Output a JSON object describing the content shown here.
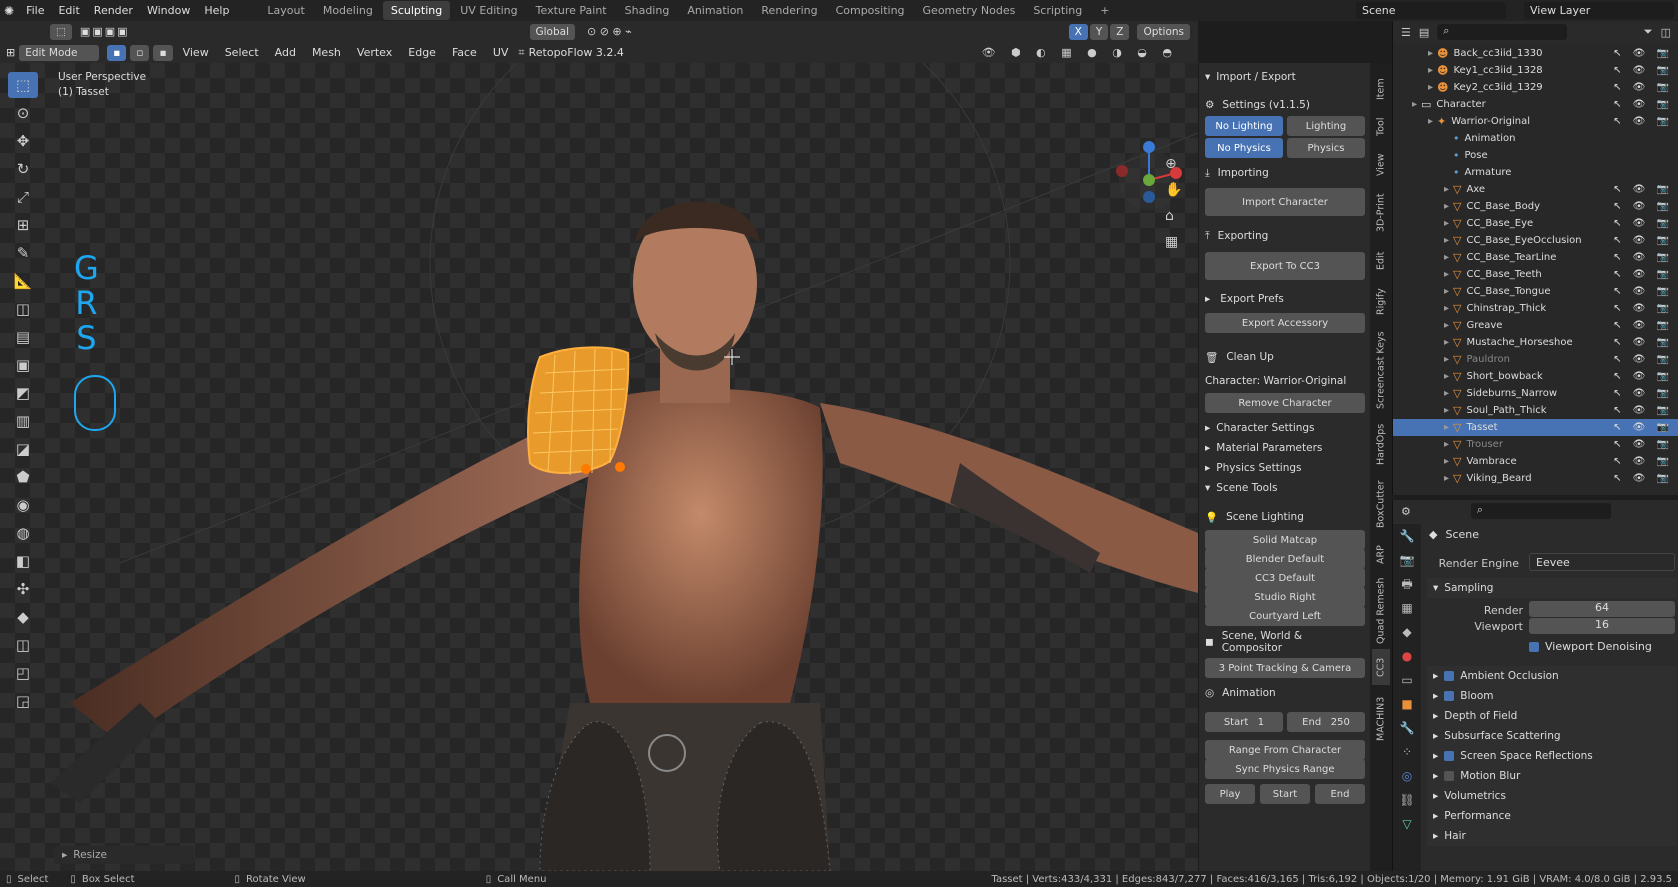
{
  "topbar": {
    "menus": [
      "File",
      "Edit",
      "Render",
      "Window",
      "Help"
    ],
    "workspaces": [
      "Layout",
      "Modeling",
      "Sculpting",
      "UV Editing",
      "Texture Paint",
      "Shading",
      "Animation",
      "Rendering",
      "Compositing",
      "Geometry Nodes",
      "Scripting"
    ],
    "active_workspace": "Sculpting",
    "scene": "Scene",
    "view_layer": "View Layer"
  },
  "header": {
    "mode": "Edit Mode",
    "menus": [
      "View",
      "Select",
      "Add",
      "Mesh",
      "Vertex",
      "Edge",
      "Face",
      "UV"
    ],
    "addon": "RetopoFlow 3.2.4",
    "orientation": "Global",
    "options": "Options"
  },
  "viewport": {
    "perspective": "User Perspective",
    "object": "(1) Tasset",
    "overlay_keys": [
      "G",
      "R",
      "S"
    ],
    "resize_panel": "Resize"
  },
  "npanel": {
    "section_title": "Import / Export",
    "settings_label": "Settings  (v1.1.5)",
    "no_lighting": "No Lighting",
    "lighting": "Lighting",
    "no_physics": "No Physics",
    "physics": "Physics",
    "importing": "Importing",
    "import_character": "Import Character",
    "exporting": "Exporting",
    "export_cc3": "Export To CC3",
    "export_prefs": "Export Prefs",
    "export_accessory": "Export Accessory",
    "clean_up": "Clean Up",
    "character": "Character: Warrior-Original",
    "remove_character": "Remove Character",
    "collapsed": [
      "Character Settings",
      "Material Parameters",
      "Physics Settings"
    ],
    "scene_tools": "Scene Tools",
    "scene_lighting": "Scene Lighting",
    "lighting_presets": [
      "Solid Matcap",
      "Blender Default",
      "CC3 Default",
      "Studio Right",
      "Courtyard Left"
    ],
    "scene_world": "Scene, World & Compositor",
    "tracking": "3 Point Tracking & Camera",
    "animation": "Animation",
    "start_label": "Start",
    "start_val": "1",
    "end_label": "End",
    "end_val": "250",
    "range_from_char": "Range From Character",
    "sync_physics": "Sync Physics Range",
    "play": "Play",
    "start_btn": "Start",
    "end_btn": "End"
  },
  "side_tabs": [
    "Item",
    "Tool",
    "View",
    "3D-Print",
    "Edit",
    "Rigify",
    "Screencast Keys",
    "HardOps",
    "BoxCutter",
    "ARP",
    "Quad Remesh",
    "CC3",
    "MACHIN3"
  ],
  "outliner": {
    "items": [
      {
        "name": "Back_cc3iid_1330",
        "depth": 2,
        "type": "ob"
      },
      {
        "name": "Key1_cc3iid_1328",
        "depth": 2,
        "type": "ob"
      },
      {
        "name": "Key2_cc3iid_1329",
        "depth": 2,
        "type": "ob"
      },
      {
        "name": "Character",
        "depth": 1,
        "type": "col"
      },
      {
        "name": "Warrior-Original",
        "depth": 2,
        "type": "arm"
      },
      {
        "name": "Animation",
        "depth": 3,
        "type": "sub"
      },
      {
        "name": "Pose",
        "depth": 3,
        "type": "sub"
      },
      {
        "name": "Armature",
        "depth": 3,
        "type": "sub"
      },
      {
        "name": "Axe",
        "depth": 3,
        "type": "mesh"
      },
      {
        "name": "CC_Base_Body",
        "depth": 3,
        "type": "mesh"
      },
      {
        "name": "CC_Base_Eye",
        "depth": 3,
        "type": "mesh"
      },
      {
        "name": "CC_Base_EyeOcclusion",
        "depth": 3,
        "type": "mesh"
      },
      {
        "name": "CC_Base_TearLine",
        "depth": 3,
        "type": "mesh"
      },
      {
        "name": "CC_Base_Teeth",
        "depth": 3,
        "type": "mesh"
      },
      {
        "name": "CC_Base_Tongue",
        "depth": 3,
        "type": "mesh"
      },
      {
        "name": "Chinstrap_Thick",
        "depth": 3,
        "type": "mesh"
      },
      {
        "name": "Greave",
        "depth": 3,
        "type": "mesh"
      },
      {
        "name": "Mustache_Horseshoe",
        "depth": 3,
        "type": "mesh"
      },
      {
        "name": "Pauldron",
        "depth": 3,
        "type": "mesh",
        "dim": true
      },
      {
        "name": "Short_bowback",
        "depth": 3,
        "type": "mesh"
      },
      {
        "name": "Sideburns_Narrow",
        "depth": 3,
        "type": "mesh"
      },
      {
        "name": "Soul_Path_Thick",
        "depth": 3,
        "type": "mesh"
      },
      {
        "name": "Tasset",
        "depth": 3,
        "type": "mesh",
        "sel": true
      },
      {
        "name": "Trouser",
        "depth": 3,
        "type": "mesh",
        "dim": true
      },
      {
        "name": "Vambrace",
        "depth": 3,
        "type": "mesh"
      },
      {
        "name": "Viking_Beard",
        "depth": 3,
        "type": "mesh"
      }
    ]
  },
  "properties": {
    "scene": "Scene",
    "render_engine_label": "Render Engine",
    "render_engine": "Eevee",
    "sampling": "Sampling",
    "render_label": "Render",
    "render_val": "64",
    "viewport_label": "Viewport",
    "viewport_val": "16",
    "viewport_denoising": "Viewport Denoising",
    "sections": [
      {
        "label": "Ambient Occlusion",
        "check": "on"
      },
      {
        "label": "Bloom",
        "check": "on"
      },
      {
        "label": "Depth of Field",
        "check": "none"
      },
      {
        "label": "Subsurface Scattering",
        "check": "none"
      },
      {
        "label": "Screen Space Reflections",
        "check": "on"
      },
      {
        "label": "Motion Blur",
        "check": "off"
      },
      {
        "label": "Volumetrics",
        "check": "none"
      },
      {
        "label": "Performance",
        "check": "none"
      },
      {
        "label": "Hair",
        "check": "none"
      }
    ]
  },
  "status": {
    "select": "Select",
    "box_select": "Box Select",
    "rotate_view": "Rotate View",
    "call_menu": "Call Menu",
    "stats": "Tasset | Verts:433/4,331 | Edges:843/7,277 | Faces:416/3,165 | Tris:6,192 | Objects:1/20 | Memory: 1.91 GiB | VRAM: 4.0/8.0 GiB | 2.93.5"
  },
  "colors": {
    "accent": "#4772b3",
    "object_orange": "#e8913a",
    "overlay_blue": "#1ea7f0"
  }
}
